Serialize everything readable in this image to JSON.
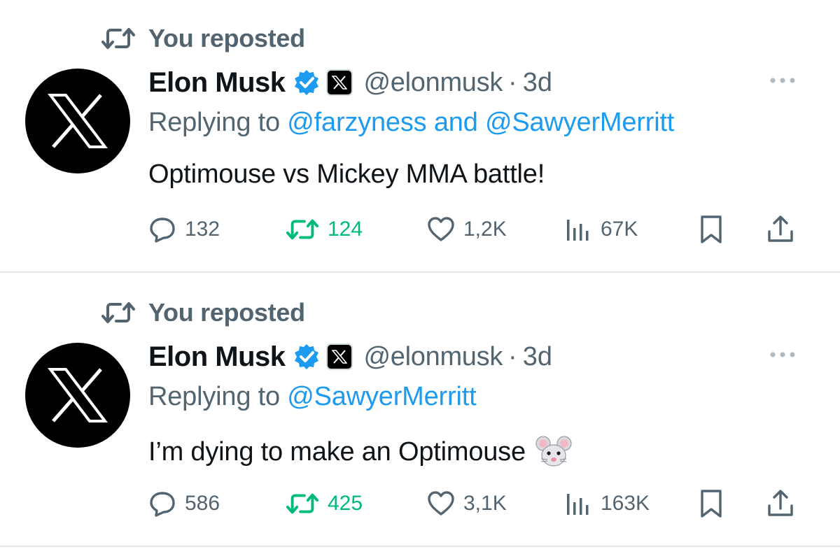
{
  "posts": [
    {
      "repost_label": "You reposted",
      "author_name": "Elon Musk",
      "author_handle": "@elonmusk",
      "separator": "·",
      "time": "3d",
      "replying_prefix": "Replying to",
      "replying_mentions": [
        {
          "text": "@farzyness"
        },
        {
          "text": " and "
        },
        {
          "text": "@SawyerMerritt"
        }
      ],
      "text": "Optimouse vs Mickey MMA battle!",
      "stats": {
        "replies": "132",
        "reposts": "124",
        "likes": "1,2K",
        "views": "67K"
      }
    },
    {
      "repost_label": "You reposted",
      "author_name": "Elon Musk",
      "author_handle": "@elonmusk",
      "separator": "·",
      "time": "3d",
      "replying_prefix": "Replying to",
      "replying_mentions": [
        {
          "text": "@SawyerMerritt"
        }
      ],
      "text": "I’m dying to make an Optimouse",
      "text_emoji": "mouse-face-emoji",
      "stats": {
        "replies": "586",
        "reposts": "425",
        "likes": "3,1K",
        "views": "163K"
      }
    }
  ],
  "colors": {
    "text": "#0f1419",
    "muted": "#536471",
    "link": "#1d9bf0",
    "repost_active": "#00ba7c",
    "verified": "#1d9bf0"
  }
}
